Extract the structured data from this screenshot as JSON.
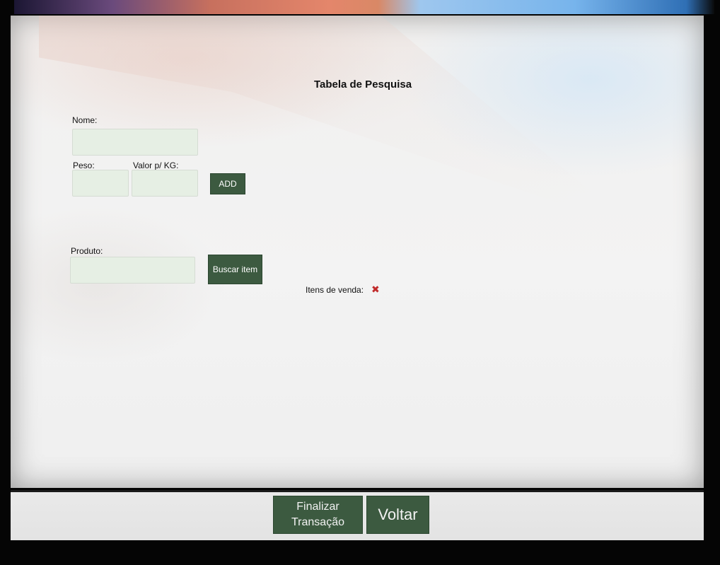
{
  "page": {
    "title": "Tabela de Pesquisa"
  },
  "add_form": {
    "name_label": "Nome:",
    "name_value": "",
    "weight_label": "Peso:",
    "weight_value": "",
    "price_label": "Valor p/ KG:",
    "price_value": "",
    "add_button": "ADD"
  },
  "search_form": {
    "product_label": "Produto:",
    "product_value": "",
    "search_button": "Buscar item"
  },
  "sale_items": {
    "label": "Itens de venda:",
    "status_icon": "x-mark-icon",
    "status_color": "#c02a2a"
  },
  "footer": {
    "finalize_line1": "Finalizar",
    "finalize_line2": "Transação",
    "back_button": "Voltar"
  },
  "colors": {
    "button_green": "#3c5a40",
    "field_green": "#e6efe4"
  }
}
